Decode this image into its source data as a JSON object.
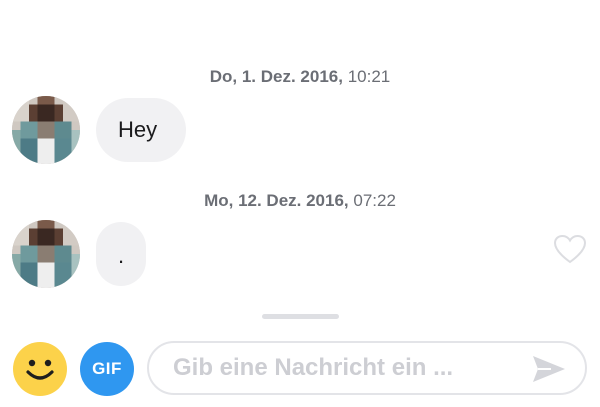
{
  "messages": [
    {
      "date": "Do, 1. Dez. 2016",
      "time": "10:21",
      "text": "Hey"
    },
    {
      "date": "Mo, 12. Dez. 2016",
      "time": "07:22",
      "text": "."
    }
  ],
  "composer": {
    "gif_label": "GIF",
    "placeholder": "Gib eine Nachricht ein ..."
  },
  "icons": {
    "emoji": "smiley-face-icon",
    "like": "heart-outline-icon",
    "send": "paper-plane-send-icon"
  },
  "colors": {
    "gif_button": "#2f97f0",
    "emoji_button": "#fcd24a",
    "bubble_bg": "#f1f1f3",
    "timestamp_text": "#6b6e75"
  }
}
